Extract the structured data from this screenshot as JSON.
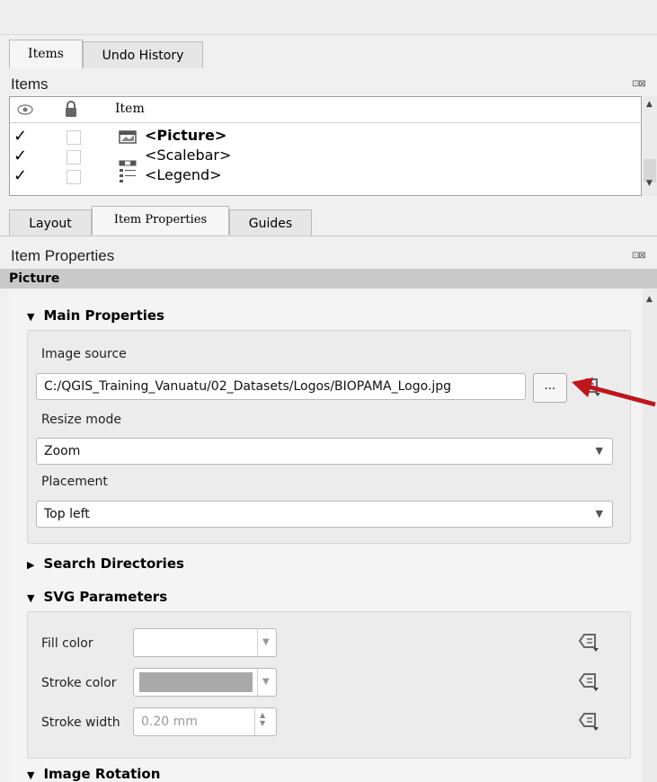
{
  "top_tabs": [
    {
      "label": "Items"
    },
    {
      "label": "Undo History"
    }
  ],
  "items_panel": {
    "title": "Items",
    "column_item": "Item",
    "rows": [
      {
        "label": "<Picture>",
        "bold": true
      },
      {
        "label": "<Scalebar>",
        "bold": false
      },
      {
        "label": "<Legend>",
        "bold": false
      }
    ]
  },
  "mid_tabs": [
    {
      "label": "Layout"
    },
    {
      "label": "Item Properties"
    },
    {
      "label": "Guides"
    }
  ],
  "props_panel": {
    "title": "Item Properties",
    "section": "Picture"
  },
  "main_properties": {
    "heading": "Main Properties",
    "image_source_label": "Image source",
    "image_source_value": "C:/QGIS_Training_Vanuatu/02_Datasets/Logos/BIOPAMA_Logo.jpg",
    "browse_label": "...",
    "resize_mode_label": "Resize mode",
    "resize_mode_value": "Zoom",
    "placement_label": "Placement",
    "placement_value": "Top left"
  },
  "search_directories": {
    "heading": "Search Directories"
  },
  "svg_parameters": {
    "heading": "SVG Parameters",
    "fill_color_label": "Fill color",
    "stroke_color_label": "Stroke color",
    "stroke_width_label": "Stroke width",
    "stroke_width_value": "0.20 mm"
  },
  "image_rotation": {
    "heading": "Image Rotation"
  },
  "colors": {
    "annotation_arrow": "#c0151b",
    "stroke_swatch": "#a9a9a9",
    "section_bar": "#c9c9c9"
  }
}
